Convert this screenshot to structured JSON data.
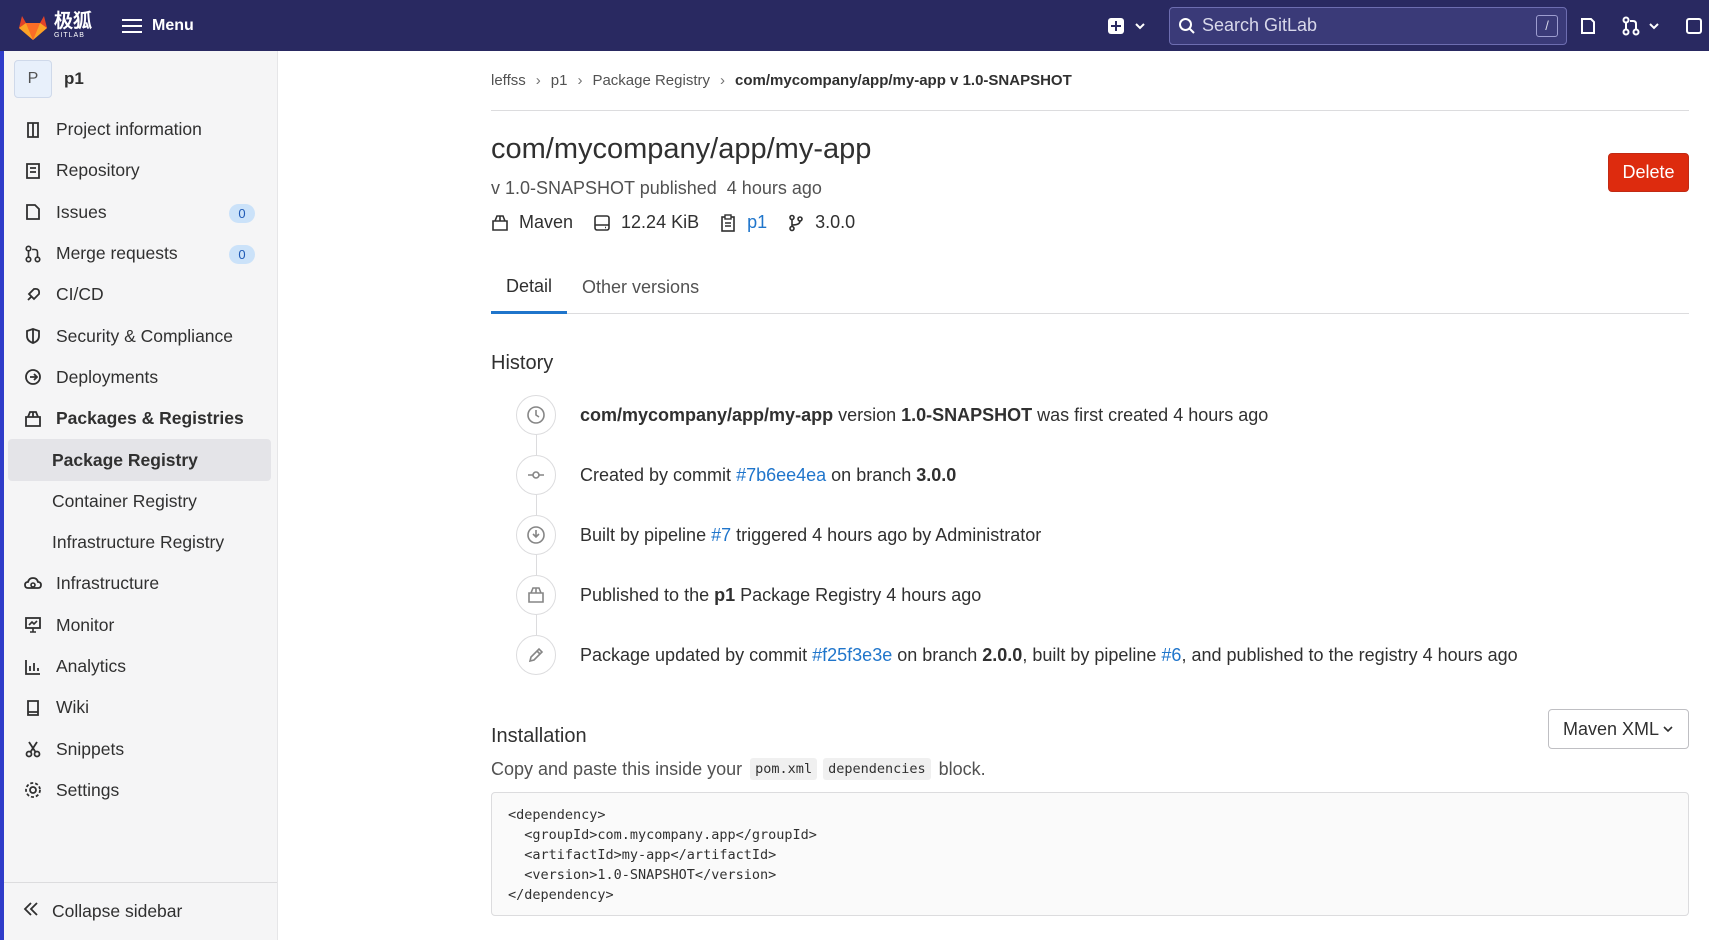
{
  "topbar": {
    "brand_cn": "极狐",
    "brand_en": "GITLAB",
    "menu_label": "Menu",
    "search_placeholder": "Search GitLab",
    "search_shortcut": "/"
  },
  "sidebar": {
    "project_initial": "P",
    "project_name": "p1",
    "items": [
      {
        "label": "Project information",
        "icon": "project-info-icon"
      },
      {
        "label": "Repository",
        "icon": "repository-icon"
      },
      {
        "label": "Issues",
        "icon": "issues-icon",
        "badge": "0"
      },
      {
        "label": "Merge requests",
        "icon": "merge-request-icon",
        "badge": "0"
      },
      {
        "label": "CI/CD",
        "icon": "rocket-icon"
      },
      {
        "label": "Security & Compliance",
        "icon": "shield-icon"
      },
      {
        "label": "Deployments",
        "icon": "deployments-icon"
      },
      {
        "label": "Packages & Registries",
        "icon": "package-icon"
      },
      {
        "label": "Package Registry"
      },
      {
        "label": "Container Registry"
      },
      {
        "label": "Infrastructure Registry"
      },
      {
        "label": "Infrastructure",
        "icon": "cloud-gear-icon"
      },
      {
        "label": "Monitor",
        "icon": "monitor-icon"
      },
      {
        "label": "Analytics",
        "icon": "chart-icon"
      },
      {
        "label": "Wiki",
        "icon": "book-icon"
      },
      {
        "label": "Snippets",
        "icon": "scissors-icon"
      },
      {
        "label": "Settings",
        "icon": "gear-icon"
      }
    ],
    "collapse_label": "Collapse sidebar"
  },
  "breadcrumb": [
    "leffss",
    "p1",
    "Package Registry",
    "com/mycompany/app/my-app v 1.0-SNAPSHOT"
  ],
  "package": {
    "title": "com/mycompany/app/my-app",
    "subtitle_version": "v 1.0-SNAPSHOT published",
    "subtitle_time": "4 hours ago",
    "type": "Maven",
    "size": "12.24 KiB",
    "project": "p1",
    "branch": "3.0.0",
    "delete_label": "Delete"
  },
  "tabs": [
    "Detail",
    "Other versions"
  ],
  "history": {
    "title": "History",
    "items": [
      {
        "p1": "com/mycompany/app/my-app",
        "p2": " version ",
        "p3": "1.0-SNAPSHOT",
        "p4": " was first created 4 hours ago"
      },
      {
        "p1": "Created by commit ",
        "p2": "#7b6ee4ea",
        "p3": " on branch ",
        "p4": "3.0.0"
      },
      {
        "p1": "Built by pipeline ",
        "p2": "#7",
        "p3": " triggered 4 hours ago by Administrator"
      },
      {
        "p1": "Published to the ",
        "p2": "p1",
        "p3": " Package Registry 4 hours ago"
      },
      {
        "p1": "Package updated by commit ",
        "p2": "#f25f3e3e",
        "p3": " on branch ",
        "p4": "2.0.0",
        "p5": ", built by pipeline ",
        "p6": "#6",
        "p7": ", and published to the registry 4 hours ago"
      }
    ]
  },
  "installation": {
    "title": "Installation",
    "select_value": "Maven XML",
    "desc_pre": "Copy and paste this inside your",
    "code1": "pom.xml",
    "code2": "dependencies",
    "desc_post": "block.",
    "snippet": "<dependency>\n  <groupId>com.mycompany.app</groupId>\n  <artifactId>my-app</artifactId>\n  <version>1.0-SNAPSHOT</version>\n</dependency>"
  },
  "colors": {
    "navbar": "#292961",
    "link": "#1f75cb",
    "danger": "#dd2b0e"
  }
}
